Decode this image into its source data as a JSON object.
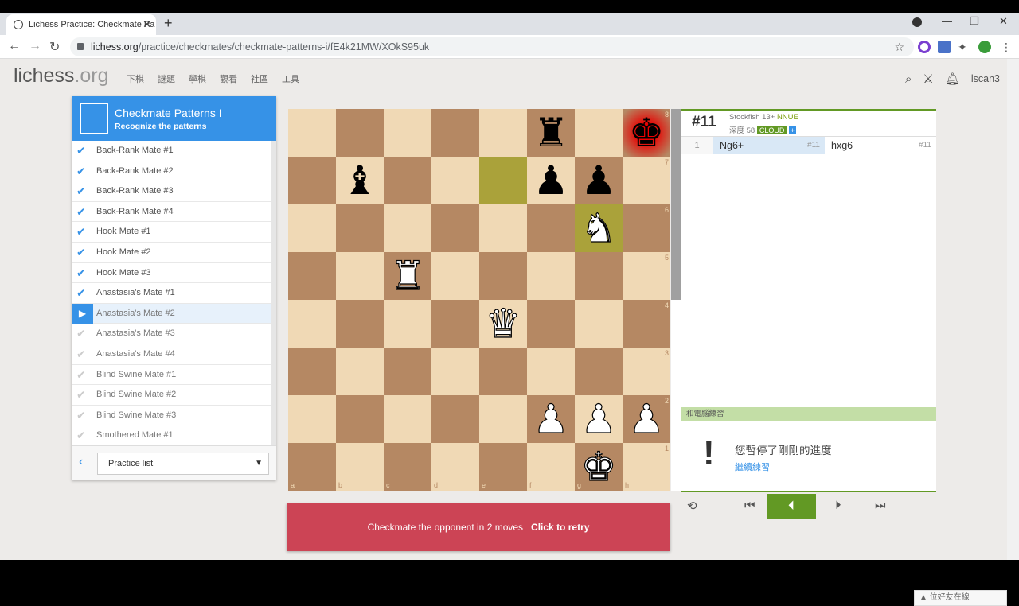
{
  "browser": {
    "tab_title": "Lichess Practice: Checkmate Pa",
    "url_host": "lichess.org",
    "url_path": "/practice/checkmates/checkmate-patterns-i/fE4k21MW/XOkS95uk"
  },
  "site": {
    "logo_main": "lichess",
    "logo_tld": ".org",
    "nav": [
      "下棋",
      "謎題",
      "學棋",
      "觀看",
      "社區",
      "工具"
    ],
    "username": "lscan3",
    "friends_label": "▲ 位好友在線"
  },
  "practice": {
    "title": "Checkmate Patterns I",
    "subtitle": "Recognize the patterns",
    "steps": [
      {
        "label": "Back-Rank Mate #1",
        "done": true
      },
      {
        "label": "Back-Rank Mate #2",
        "done": true
      },
      {
        "label": "Back-Rank Mate #3",
        "done": true
      },
      {
        "label": "Back-Rank Mate #4",
        "done": true
      },
      {
        "label": "Hook Mate #1",
        "done": true
      },
      {
        "label": "Hook Mate #2",
        "done": true
      },
      {
        "label": "Hook Mate #3",
        "done": true
      },
      {
        "label": "Anastasia's Mate #1",
        "done": true
      },
      {
        "label": "Anastasia's Mate #2",
        "done": false,
        "active": true
      },
      {
        "label": "Anastasia's Mate #3",
        "done": false
      },
      {
        "label": "Anastasia's Mate #4",
        "done": false
      },
      {
        "label": "Blind Swine Mate #1",
        "done": false
      },
      {
        "label": "Blind Swine Mate #2",
        "done": false
      },
      {
        "label": "Blind Swine Mate #3",
        "done": false
      },
      {
        "label": "Smothered Mate #1",
        "done": false
      }
    ],
    "select_value": "Practice list"
  },
  "board": {
    "files": [
      "a",
      "b",
      "c",
      "d",
      "e",
      "f",
      "g",
      "h"
    ],
    "ranks": [
      "8",
      "7",
      "6",
      "5",
      "4",
      "3",
      "2",
      "1"
    ],
    "pieces": {
      "f8": "♜b",
      "h8": "♚b",
      "b7": "♝b",
      "f7": "♟b",
      "g7": "♟b",
      "g6": "♞w",
      "c5": "♜w",
      "e4": "♛w",
      "f2": "♟w",
      "g2": "♟w",
      "h2": "♟w",
      "g1": "♚w"
    },
    "highlight": [
      "e7",
      "g6"
    ],
    "check": "h8",
    "eval_white_fraction": 0.5
  },
  "analysis": {
    "depth_badge": "#11",
    "engine_name": "Stockfish 13+",
    "engine_nnue": "NNUE",
    "depth_label": "深度 58",
    "cloud_label": "CLOUD",
    "move_number": "1",
    "white_move": "Ng6+",
    "white_eval": "#11",
    "black_move": "hxg6",
    "black_eval": "#11",
    "feedback_title": "和電腦練習",
    "feedback_message": "您暫停了剛剛的進度",
    "feedback_link": "繼續練習"
  },
  "banner": {
    "goal": "Checkmate the opponent in 2 moves",
    "retry": "Click to retry"
  }
}
